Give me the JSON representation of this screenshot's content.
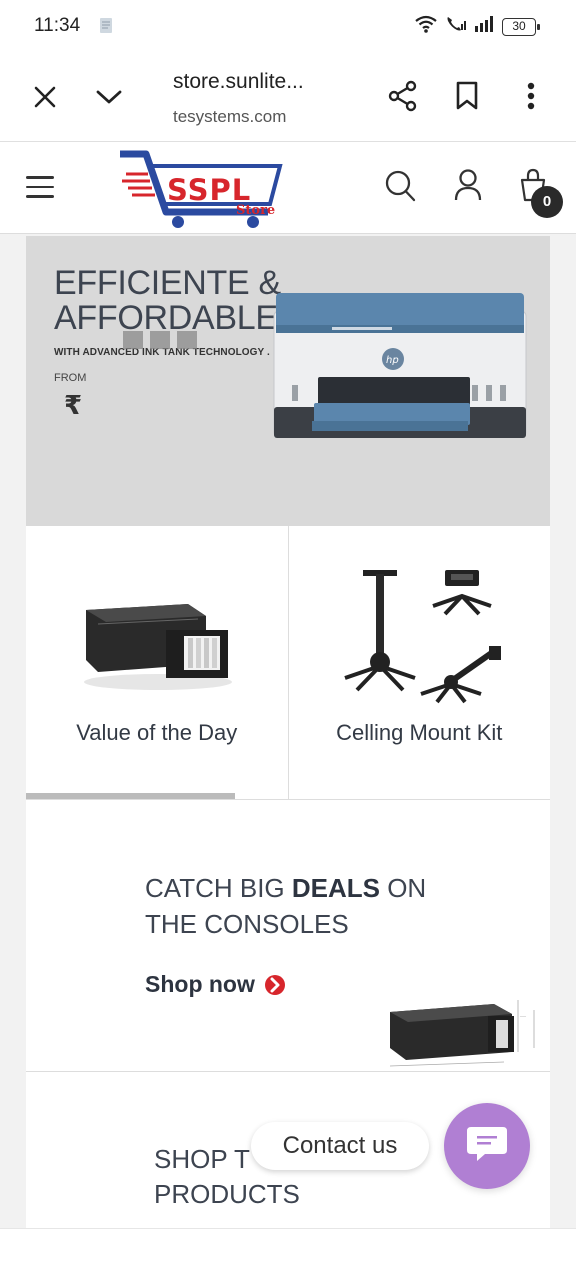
{
  "status_bar": {
    "time": "11:34",
    "battery": "30"
  },
  "browser": {
    "url_main": "store.sunlite...",
    "url_sub": "tesystems.com"
  },
  "header": {
    "logo_text": "SSPL",
    "logo_sub": "Store",
    "cart_count": "0"
  },
  "hero": {
    "title_line1": "EFFICIENTE &",
    "title_line2": "AFFORDABLE.",
    "subtitle": "WITH ADVANCED INK TANK TECHNOLOGY .",
    "from_label": "FROM",
    "currency": "₹"
  },
  "tiles": [
    {
      "label": "Value of the Day"
    },
    {
      "label": "Celling Mount Kit"
    }
  ],
  "deals": {
    "title_pre": "CATCH BIG ",
    "title_bold": "DEALS",
    "title_post": " ON",
    "title_line2": "THE CONSOLES",
    "cta": "Shop now"
  },
  "shop_section": {
    "title_line1": "SHOP T",
    "title_line2": "PRODUCTS"
  },
  "contact": {
    "label": "Contact us"
  },
  "colors": {
    "brand_red": "#d7262c",
    "brand_blue": "#2b4aa0",
    "fab_purple": "#b07fd3",
    "printer_blue": "#4e7da3"
  }
}
